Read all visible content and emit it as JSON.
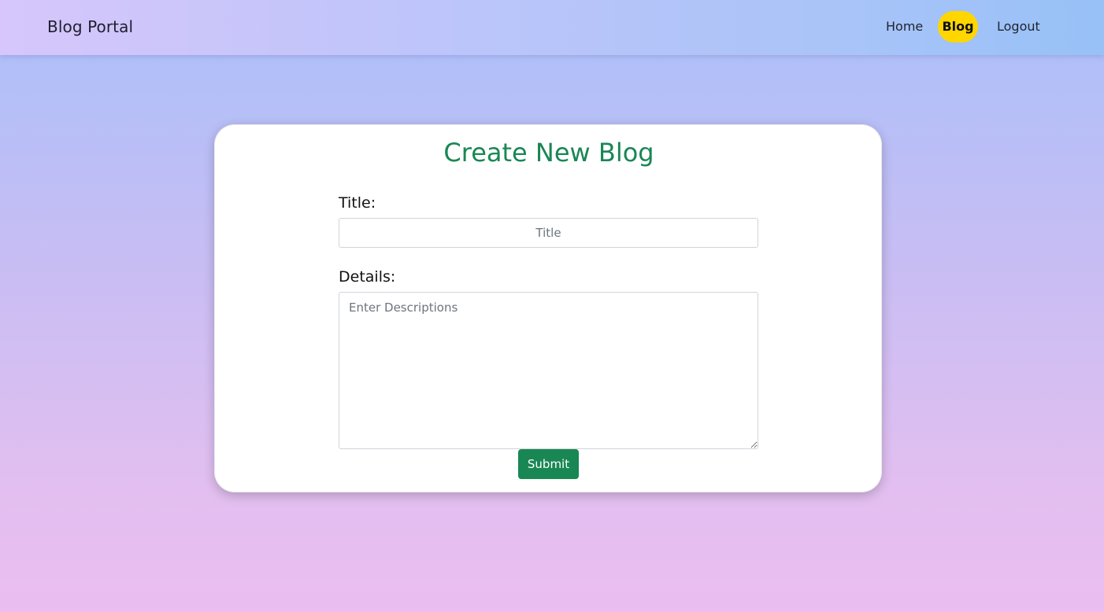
{
  "navbar": {
    "brand": "Blog Portal",
    "items": [
      {
        "label": "Home"
      },
      {
        "label": "Blog",
        "active": true
      },
      {
        "label": "Logout"
      }
    ],
    "active_color": "#ffd600"
  },
  "form": {
    "heading": "Create New Blog",
    "title_label": "Title:",
    "title_value": "",
    "title_placeholder": "Title",
    "details_label": "Details:",
    "details_value": "",
    "details_placeholder": "Enter Descriptions",
    "submit_label": "Submit",
    "accent_color": "#198754"
  }
}
